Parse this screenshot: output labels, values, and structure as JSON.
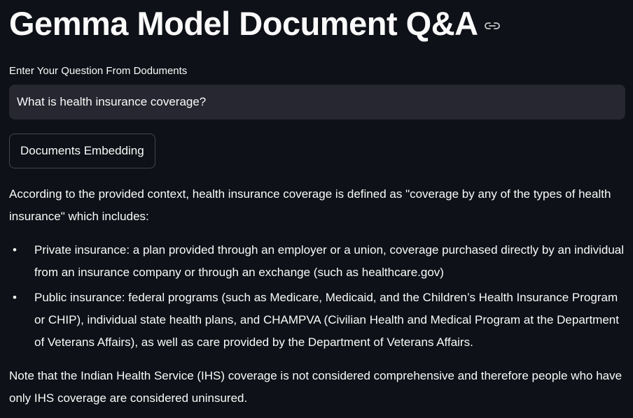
{
  "header": {
    "title": "Gemma Model Document Q&A",
    "anchor_icon": "link-icon"
  },
  "question": {
    "label": "Enter Your Question From Doduments",
    "value": "What is health insurance coverage?"
  },
  "embed_button": {
    "label": "Documents Embedding"
  },
  "answer": {
    "intro": "According to the provided context, health insurance coverage is defined as \"coverage by any of the types of health insurance\" which includes:",
    "items": [
      "Private insurance: a plan provided through an employer or a union, coverage purchased directly by an individual from an insurance company or through an exchange (such as healthcare.gov)",
      "Public insurance: federal programs (such as Medicare, Medicaid, and the Children’s Health Insurance Program or CHIP), individual state health plans, and CHAMPVA (Civilian Health and Medical Program at the Department of Veterans Affairs), as well as care provided by the Department of Veterans Affairs."
    ],
    "note": "Note that the Indian Health Service (IHS) coverage is not considered comprehensive and therefore people who have only IHS coverage are considered uninsured."
  },
  "colors": {
    "background": "#0e1117",
    "input_background": "#262730",
    "text": "#fafafa",
    "button_border": "#43464f"
  }
}
